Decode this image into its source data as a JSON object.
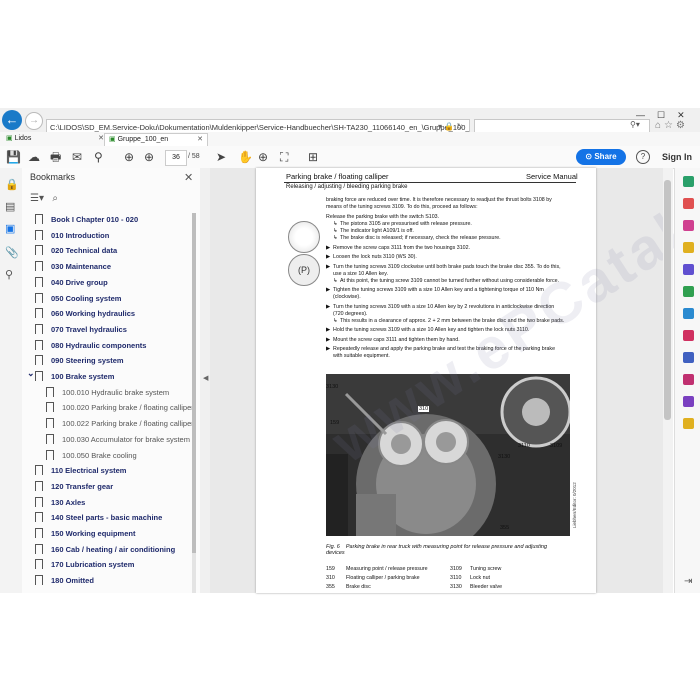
{
  "browser": {
    "url": "C:\\LIDOS\\SD_EM.Service-Doku\\Dokumentation\\Muldenkipper\\Service-Handbuecher\\SH-TA230_11066140_en_\\Gruppe_100_en.pdf",
    "tabs": [
      {
        "label": "Lidos"
      },
      {
        "label": "Gruppe_100_en"
      }
    ]
  },
  "toolbar": {
    "page_current": "36",
    "page_total": "/ 58",
    "share_label": "Share",
    "help_label": "?",
    "signin_label": "Sign In"
  },
  "bookmarks": {
    "title": "Bookmarks",
    "items": [
      {
        "label": "Book I Chapter 010 - 020",
        "level": 0
      },
      {
        "label": "010 Introduction",
        "level": 0
      },
      {
        "label": "020 Technical data",
        "level": 0
      },
      {
        "label": "030 Maintenance",
        "level": 0
      },
      {
        "label": "040 Drive group",
        "level": 0
      },
      {
        "label": "050 Cooling system",
        "level": 0
      },
      {
        "label": "060 Working hydraulics",
        "level": 0
      },
      {
        "label": "070 Travel hydraulics",
        "level": 0
      },
      {
        "label": "080 Hydraulic components",
        "level": 0
      },
      {
        "label": "090 Steering system",
        "level": 0
      },
      {
        "label": "100 Brake system",
        "level": 0,
        "expanded": true
      },
      {
        "label": "100.010 Hydraulic brake system",
        "level": 1
      },
      {
        "label": "100.020 Parking brake / floating calliper",
        "level": 1
      },
      {
        "label": "100.022 Parking brake / floating calliper",
        "level": 1
      },
      {
        "label": "100.030 Accumulator for brake system",
        "level": 1
      },
      {
        "label": "100.050 Brake cooling",
        "level": 1
      },
      {
        "label": "110 Electrical system",
        "level": 0
      },
      {
        "label": "120 Transfer gear",
        "level": 0
      },
      {
        "label": "130 Axles",
        "level": 0
      },
      {
        "label": "140 Steel parts - basic machine",
        "level": 0
      },
      {
        "label": "150 Working equipment",
        "level": 0
      },
      {
        "label": "160 Cab / heating / air conditioning",
        "level": 0
      },
      {
        "label": "170 Lubrication system",
        "level": 0
      },
      {
        "label": "180 Omitted",
        "level": 0
      }
    ]
  },
  "document": {
    "header_title": "Parking brake / floating calliper",
    "header_right": "Service Manual",
    "header_sub": "Releasing / adjusting / bleeding parking brake",
    "intro": [
      "braking force are reduced over time. It is therefore necessary to readjust the thrust bolts 3108 by",
      "means of the tuning screws 3109. To do this, proceed as follows:"
    ],
    "lines": [
      {
        "kind": "text",
        "text": "Release the parking brake with the switch S103."
      },
      {
        "kind": "result",
        "text": "The pistons 3105 are pressurised with release pressure."
      },
      {
        "kind": "result",
        "text": "The indicator light A109/1 is off."
      },
      {
        "kind": "result",
        "text": "The brake disc is released; if necessary, check the release pressure."
      },
      {
        "kind": "step",
        "text": "Remove the screw caps 3111 from the two housings 3102."
      },
      {
        "kind": "step",
        "text": "Loosen the lock nuts 3110 (WS 30)."
      },
      {
        "kind": "step",
        "text": "Turn the tuning screws 3109 clockwise until both brake pads touch the brake disc 355. To do this,"
      },
      {
        "kind": "cont",
        "text": "use a size 10 Allen key."
      },
      {
        "kind": "result",
        "text": "At this point, the tuning screw 3109 cannot be turned further without using considerable force."
      },
      {
        "kind": "step",
        "text": "Tighten the tuning screws 3109 with a size 10 Allen key and a tightening torque of 110 Nm"
      },
      {
        "kind": "cont",
        "text": "(clockwise)."
      },
      {
        "kind": "step",
        "text": "Turn the tuning screws 3109 with a size 10 Allen key by 2 revolutions in anticlockwise direction"
      },
      {
        "kind": "cont",
        "text": "(720 degrees)."
      },
      {
        "kind": "result",
        "text": "This results in a clearance of approx. 2 + 2 mm between the brake disc and the two brake pads."
      },
      {
        "kind": "step",
        "text": "Hold the tuning screws 3109 with a size 10 Allen key and tighten the lock nuts 3110."
      },
      {
        "kind": "step",
        "text": "Mount the screw caps 3111 and tighten them by hand."
      },
      {
        "kind": "step",
        "text": "Repeatedly release and apply the parking brake and test the braking force of the parking brake"
      },
      {
        "kind": "cont",
        "text": "with suitable equipment."
      }
    ],
    "callouts": [
      "3130",
      "310",
      "159",
      "3110",
      "3109",
      "3130",
      "355"
    ],
    "figure_label": "Fig. 6",
    "figure_caption": "Parking brake in rear truck with measuring point for release pressure and adjusting devices",
    "legend": [
      {
        "num": "159",
        "desc": "Measuring point / release pressure"
      },
      {
        "num": "310",
        "desc": "Floating calliper / parking brake"
      },
      {
        "num": "355",
        "desc": "Brake disc"
      },
      {
        "num": "3109",
        "desc": "Tuning screw"
      },
      {
        "num": "3110",
        "desc": "Lock nut"
      },
      {
        "num": "3130",
        "desc": "Bleeder valve"
      }
    ],
    "side_stamp": "Liebherr/Editor: 0/2012",
    "watermark": "www.ePCatalogs.com"
  },
  "colors": {
    "accent": "#1473e6",
    "bookmark_text": "#1f2a6b"
  }
}
